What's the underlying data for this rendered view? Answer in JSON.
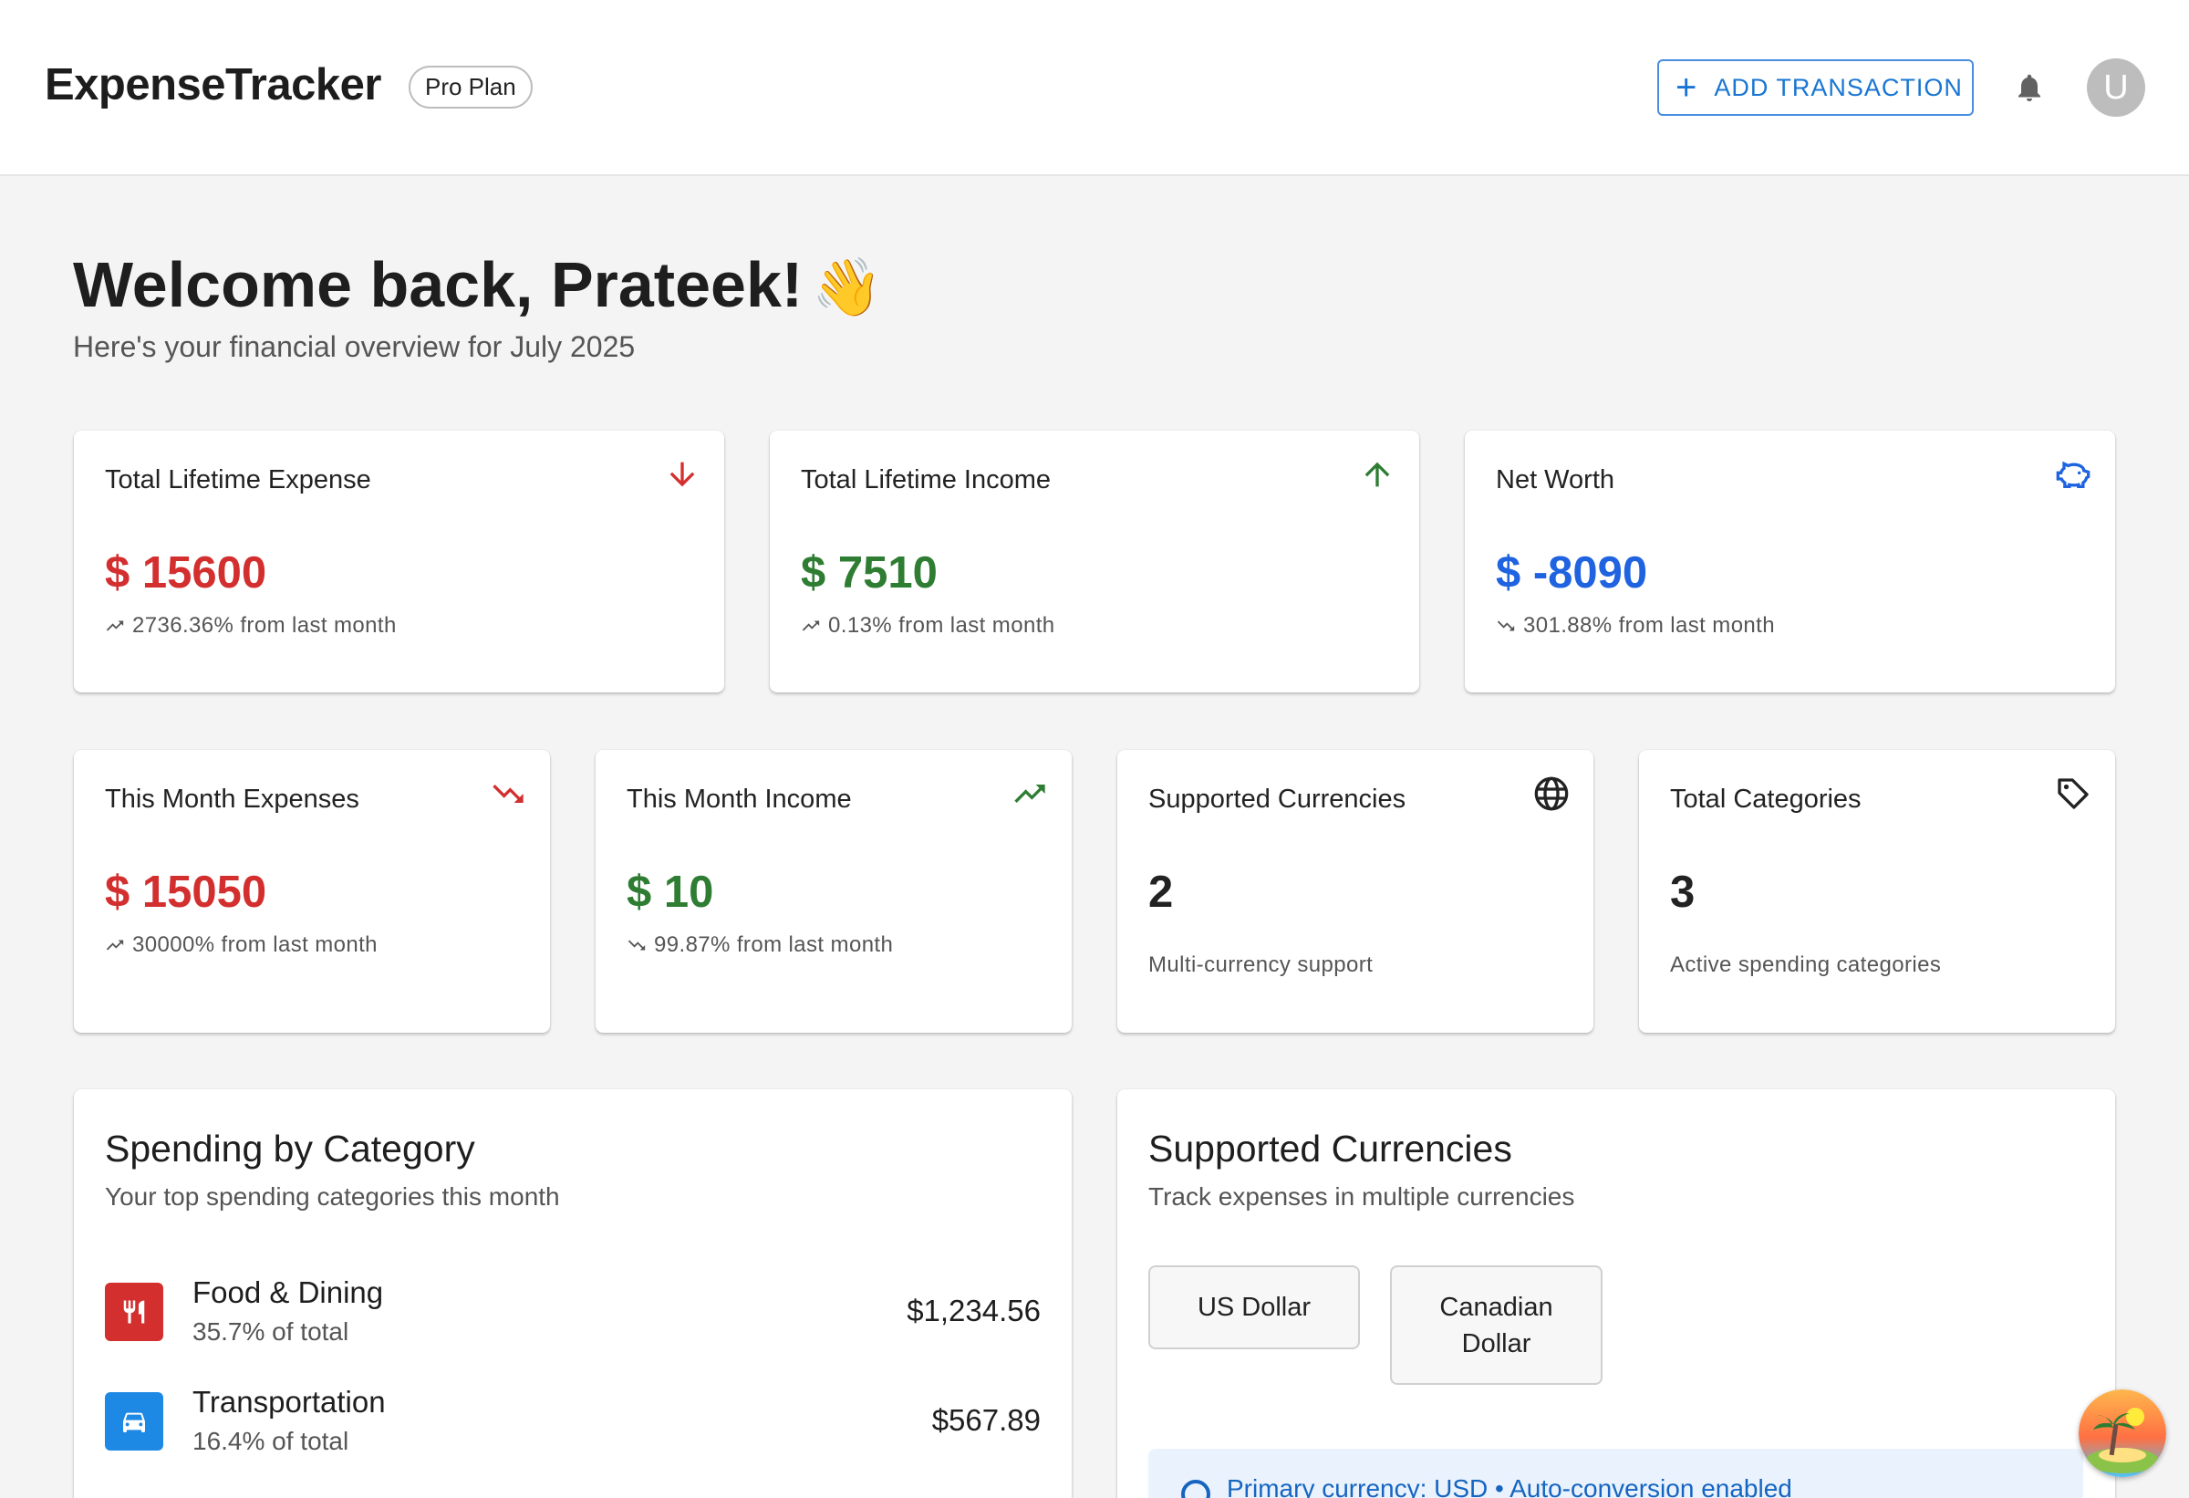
{
  "header": {
    "brand": "ExpenseTracker",
    "plan": "Pro Plan",
    "add_button": "ADD TRANSACTION",
    "avatar_initial": "U"
  },
  "welcome": {
    "title": "Welcome back, Prateek!",
    "emoji": "👋",
    "subtitle": "Here's your financial overview for July 2025"
  },
  "summary_cards": [
    {
      "label": "Total Lifetime Expense",
      "value": "$ 15600",
      "delta": "2736.36% from last month",
      "icon": "arrow-down-icon",
      "color": "#d32f2f"
    },
    {
      "label": "Total Lifetime Income",
      "value": "$ 7510",
      "delta": "0.13% from last month",
      "icon": "arrow-up-icon",
      "color": "#2e7d32"
    },
    {
      "label": "Net Worth",
      "value": "$ -8090",
      "delta": "301.88% from last month",
      "icon": "piggy-bank-icon",
      "color": "#1f63e0"
    }
  ],
  "month_cards": [
    {
      "label": "This Month Expenses",
      "value": "$ 15050",
      "delta": "30000% from last month",
      "icon": "trending-down-icon"
    },
    {
      "label": "This Month Income",
      "value": "$ 10",
      "delta": "99.87% from last month",
      "icon": "trending-up-icon"
    },
    {
      "label": "Supported Currencies",
      "value": "2",
      "note": "Multi-currency support",
      "icon": "globe-icon"
    },
    {
      "label": "Total Categories",
      "value": "3",
      "note": "Active spending categories",
      "icon": "tag-icon"
    }
  ],
  "spending": {
    "title": "Spending by Category",
    "subtitle": "Your top spending categories this month",
    "items": [
      {
        "name": "Food & Dining",
        "pct": "35.7% of total",
        "amount": "$1,234.56",
        "icon": "restaurant-icon",
        "color": "#d32f2f"
      },
      {
        "name": "Transportation",
        "pct": "16.4% of total",
        "amount": "$567.89",
        "icon": "car-icon",
        "color": "#1e88e5"
      }
    ]
  },
  "currencies": {
    "title": "Supported Currencies",
    "subtitle": "Track expenses in multiple currencies",
    "items": [
      "US Dollar",
      "Canadian Dollar"
    ],
    "info": "Primary currency: USD • Auto-conversion enabled"
  },
  "colors": {
    "accent": "#1976d2",
    "expense": "#d32f2f",
    "income": "#2e7d32",
    "networth": "#1f63e0"
  }
}
